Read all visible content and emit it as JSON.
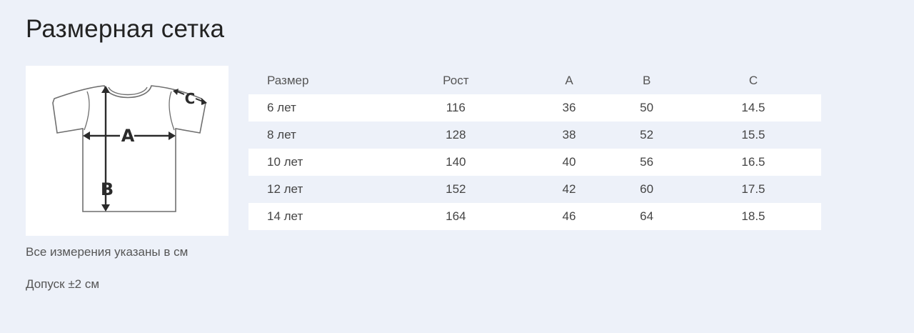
{
  "title": "Размерная сетка",
  "image": {
    "label_a": "A",
    "label_b": "B",
    "label_c": "C"
  },
  "notes": [
    "Все измерения указаны в см",
    "Допуск ±2 см"
  ],
  "table": {
    "headers": [
      "Размер",
      "Рост",
      "A",
      "B",
      "C"
    ],
    "rows": [
      [
        "6 лет",
        "116",
        "36",
        "50",
        "14.5"
      ],
      [
        "8 лет",
        "128",
        "38",
        "52",
        "15.5"
      ],
      [
        "10 лет",
        "140",
        "40",
        "56",
        "16.5"
      ],
      [
        "12 лет",
        "152",
        "42",
        "60",
        "17.5"
      ],
      [
        "14 лет",
        "164",
        "46",
        "64",
        "18.5"
      ]
    ]
  },
  "colors": {
    "background": "#edf1f9",
    "row_highlight": "#ffffff",
    "text": "#444444"
  }
}
